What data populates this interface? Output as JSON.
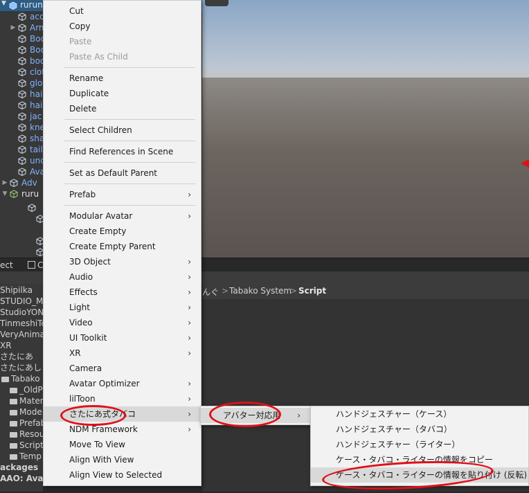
{
  "hierarchy": {
    "selected_label": "rurune",
    "items": [
      {
        "label": "acc",
        "color": "blue",
        "arrow": ""
      },
      {
        "label": "Arm",
        "color": "blue",
        "arrow": "▶"
      },
      {
        "label": "Bod",
        "color": "blue",
        "arrow": ""
      },
      {
        "label": "Bod",
        "color": "blue",
        "arrow": ""
      },
      {
        "label": "boo",
        "color": "blue",
        "arrow": ""
      },
      {
        "label": "clot",
        "color": "blue",
        "arrow": ""
      },
      {
        "label": "glo",
        "color": "blue",
        "arrow": ""
      },
      {
        "label": "hai",
        "color": "blue",
        "arrow": ""
      },
      {
        "label": "hai",
        "color": "blue",
        "arrow": ""
      },
      {
        "label": "jac",
        "color": "blue",
        "arrow": ""
      },
      {
        "label": "kne",
        "color": "blue",
        "arrow": ""
      },
      {
        "label": "sha",
        "color": "blue",
        "arrow": ""
      },
      {
        "label": "tail",
        "color": "blue",
        "arrow": ""
      },
      {
        "label": "und",
        "color": "blue",
        "arrow": ""
      },
      {
        "label": "Ava",
        "color": "blue",
        "arrow": ""
      },
      {
        "label": "Adv",
        "color": "blue",
        "arrow": "▶"
      },
      {
        "label": "ruru",
        "color": "white",
        "arrow": "▼"
      }
    ]
  },
  "tabs": {
    "project": "ect",
    "console_icon": "console-icon",
    "console": "C"
  },
  "breadcrumb": {
    "part1": "んぐ",
    "sep1": ">",
    "part2": "Tabako System",
    "sep2": ">",
    "part3": "Script"
  },
  "project_tree": [
    {
      "label": "Shipilka",
      "folder": false
    },
    {
      "label": "STUDIO_M",
      "folder": false
    },
    {
      "label": "StudioYON",
      "folder": false
    },
    {
      "label": "TinmeshiTo",
      "folder": false
    },
    {
      "label": "VeryAnima",
      "folder": false
    },
    {
      "label": "XR",
      "folder": false
    },
    {
      "label": "さたにあ",
      "folder": false
    },
    {
      "label": "さたにあしょっ",
      "folder": false
    },
    {
      "label": "Tabako",
      "folder": true
    },
    {
      "label": "_OldP",
      "folder": true
    },
    {
      "label": "Mater",
      "folder": true
    },
    {
      "label": "Mode",
      "folder": true
    },
    {
      "label": "Prefab",
      "folder": true
    },
    {
      "label": "Resou",
      "folder": true
    },
    {
      "label": "Script",
      "folder": true
    },
    {
      "label": "Temp",
      "folder": true
    },
    {
      "label": "ackages",
      "folder": false
    },
    {
      "label": "AAO: Avata",
      "folder": false
    }
  ],
  "context_menu": {
    "groups": [
      [
        {
          "label": "Cut",
          "disabled": false,
          "submenu": false
        },
        {
          "label": "Copy",
          "disabled": false,
          "submenu": false
        },
        {
          "label": "Paste",
          "disabled": true,
          "submenu": false
        },
        {
          "label": "Paste As Child",
          "disabled": true,
          "submenu": false
        }
      ],
      [
        {
          "label": "Rename",
          "disabled": false,
          "submenu": false
        },
        {
          "label": "Duplicate",
          "disabled": false,
          "submenu": false
        },
        {
          "label": "Delete",
          "disabled": false,
          "submenu": false
        }
      ],
      [
        {
          "label": "Select Children",
          "disabled": false,
          "submenu": false
        }
      ],
      [
        {
          "label": "Find References in Scene",
          "disabled": false,
          "submenu": false
        }
      ],
      [
        {
          "label": "Set as Default Parent",
          "disabled": false,
          "submenu": false
        }
      ],
      [
        {
          "label": "Prefab",
          "disabled": false,
          "submenu": true
        }
      ],
      [
        {
          "label": "Modular Avatar",
          "disabled": false,
          "submenu": true
        },
        {
          "label": "Create Empty",
          "disabled": false,
          "submenu": false
        },
        {
          "label": "Create Empty Parent",
          "disabled": false,
          "submenu": false
        },
        {
          "label": "3D Object",
          "disabled": false,
          "submenu": true
        },
        {
          "label": "Audio",
          "disabled": false,
          "submenu": true
        },
        {
          "label": "Effects",
          "disabled": false,
          "submenu": true
        },
        {
          "label": "Light",
          "disabled": false,
          "submenu": true
        },
        {
          "label": "Video",
          "disabled": false,
          "submenu": true
        },
        {
          "label": "UI Toolkit",
          "disabled": false,
          "submenu": true
        },
        {
          "label": "XR",
          "disabled": false,
          "submenu": true
        },
        {
          "label": "Camera",
          "disabled": false,
          "submenu": false
        },
        {
          "label": "Avatar Optimizer",
          "disabled": false,
          "submenu": true
        },
        {
          "label": "lilToon",
          "disabled": false,
          "submenu": true
        },
        {
          "label": "さたにあ式タバコ",
          "disabled": false,
          "submenu": true,
          "highlight": true
        },
        {
          "label": "NDM Framework",
          "disabled": false,
          "submenu": true
        },
        {
          "label": "Move To View",
          "disabled": false,
          "submenu": false
        },
        {
          "label": "Align With View",
          "disabled": false,
          "submenu": false
        },
        {
          "label": "Align View to Selected",
          "disabled": false,
          "submenu": false
        }
      ]
    ]
  },
  "submenu1": {
    "items": [
      {
        "label": "アバター対応用",
        "submenu": true,
        "highlight": true
      }
    ]
  },
  "submenu2": {
    "items": [
      {
        "label": "ハンドジェスチャー（ケース）"
      },
      {
        "label": "ハンドジェスチャー（タバコ）"
      },
      {
        "label": "ハンドジェスチャー（ライター）"
      },
      {
        "label": "ケース・タバコ・ライターの情報をコピー"
      },
      {
        "label": "ケース・タバコ・ライターの情報を貼り付け (反転)",
        "highlight": true
      }
    ]
  },
  "submenu_arrow": "›",
  "colors": {
    "highlight_oval": "#e0101a",
    "selection": "#2c5d87",
    "menu_bg": "#f2f2f2"
  }
}
